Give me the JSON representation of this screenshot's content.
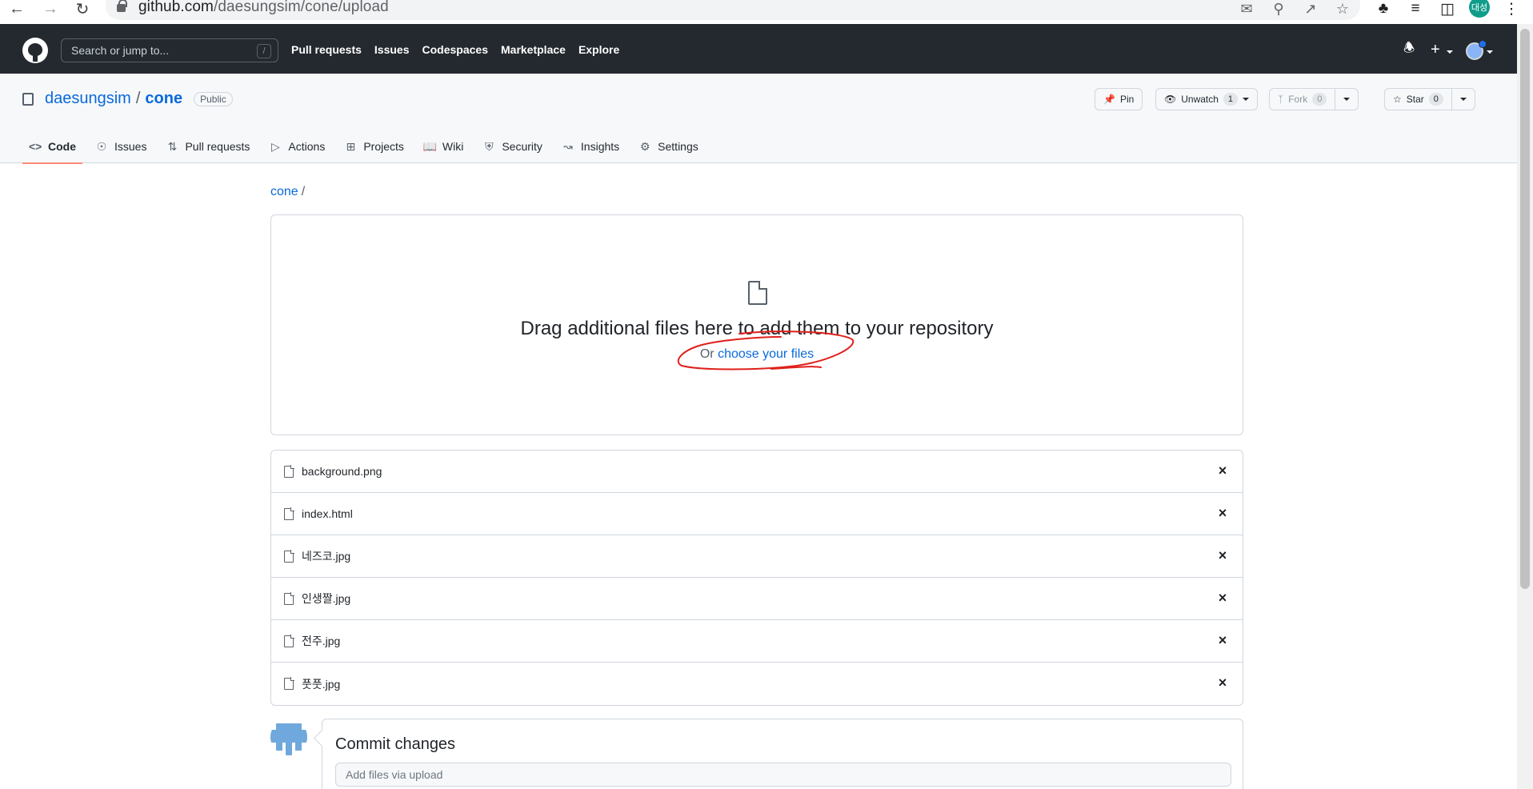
{
  "browser": {
    "url_host": "github.com",
    "url_path": "/daesungsim/cone/upload",
    "profile_initials": "대성",
    "icons": [
      "back-icon",
      "forward-icon",
      "reload-icon",
      "translate-icon",
      "zoom-icon",
      "share-icon",
      "bookmark-star-icon",
      "extensions-icon",
      "reading-list-icon",
      "side-panel-icon",
      "menu-icon"
    ]
  },
  "header": {
    "search_placeholder": "Search or jump to...",
    "search_shortcut": "/",
    "nav": [
      "Pull requests",
      "Issues",
      "Codespaces",
      "Marketplace",
      "Explore"
    ]
  },
  "repo": {
    "owner": "daesungsim",
    "separator": "/",
    "name": "cone",
    "visibility": "Public",
    "pin_label": "Pin",
    "unwatch_label": "Unwatch",
    "watch_count": "1",
    "fork_label": "Fork",
    "fork_count": "0",
    "star_label": "Star",
    "star_count": "0",
    "tabs": [
      {
        "label": "Code",
        "icon": "code-icon",
        "active": true
      },
      {
        "label": "Issues",
        "icon": "issue-icon"
      },
      {
        "label": "Pull requests",
        "icon": "pull-request-icon"
      },
      {
        "label": "Actions",
        "icon": "play-icon"
      },
      {
        "label": "Projects",
        "icon": "table-icon"
      },
      {
        "label": "Wiki",
        "icon": "book-icon"
      },
      {
        "label": "Security",
        "icon": "shield-icon"
      },
      {
        "label": "Insights",
        "icon": "graph-icon"
      },
      {
        "label": "Settings",
        "icon": "gear-icon"
      }
    ]
  },
  "breadcrumb": {
    "repo": "cone",
    "separator": "/"
  },
  "dropzone": {
    "title": "Drag additional files here to add them to your repository",
    "prefix": "Or ",
    "link": "choose your files",
    "annotation_color": "#e0201b"
  },
  "files": [
    {
      "name": "background.png"
    },
    {
      "name": "index.html"
    },
    {
      "name": "네즈코.jpg"
    },
    {
      "name": "인생짤.jpg"
    },
    {
      "name": "전주.jpg"
    },
    {
      "name": "풋풋.jpg"
    }
  ],
  "commit": {
    "title": "Commit changes",
    "placeholder": "Add files via upload"
  },
  "colors": {
    "header_bg": "#24292f",
    "link": "#0969da",
    "active_tab_underline": "#fd8c73"
  }
}
